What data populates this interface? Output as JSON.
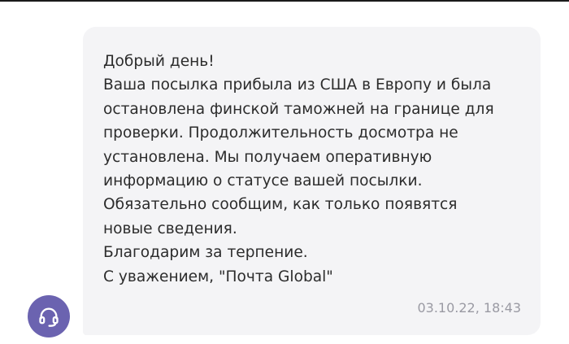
{
  "chat": {
    "message": {
      "lines": [
        "Добрый день!",
        "Ваша посылка прибыла из США в Европу и была",
        "остановлена финской таможней на границе для",
        "проверки. Продолжительность досмотра не",
        "установлена. Мы получаем оперативную",
        "информацию о статусе вашей посылки.",
        "Обязательно сообщим, как только появятся",
        "новые сведения.",
        "Благодарим за терпение.",
        "С уважением, \"Почта Global\""
      ],
      "timestamp": "03.10.22, 18:43"
    },
    "avatar": {
      "icon": "headset-icon",
      "color": "#6b63b0"
    }
  }
}
